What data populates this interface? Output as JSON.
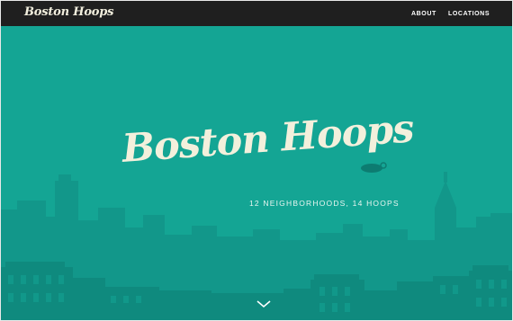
{
  "header": {
    "logo": "Boston Hoops",
    "nav": [
      {
        "label": "ABOUT"
      },
      {
        "label": "LOCATIONS"
      }
    ]
  },
  "hero": {
    "title": "Boston Hoops",
    "subtitle": "12 NEIGHBORHOODS, 14 HOOPS"
  },
  "colors": {
    "background": "#14a594",
    "navbar": "#1f1f1f",
    "skyline_far": "#12978a",
    "skyline_near": "#0f8a7e",
    "title": "#f3f0dc"
  },
  "icons": {
    "scroll": "chevron-down-icon"
  }
}
